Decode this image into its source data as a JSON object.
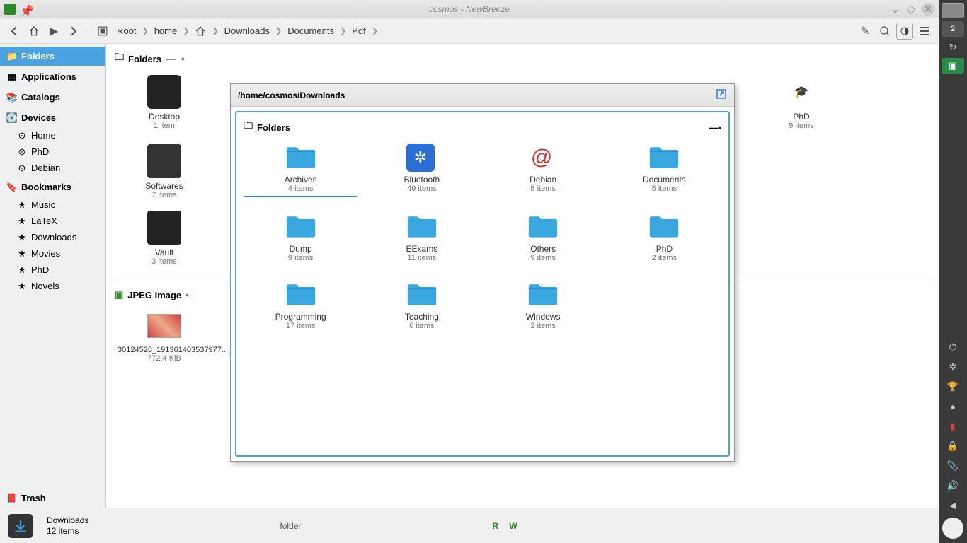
{
  "window": {
    "title": "cosmos - NewBreeze"
  },
  "breadcrumb": {
    "root": "Root",
    "home": "home",
    "downloads": "Downloads",
    "documents": "Documents",
    "pdf": "Pdf"
  },
  "sidebar": {
    "folders": "Folders",
    "applications": "Applications",
    "catalogs": "Catalogs",
    "devices": "Devices",
    "dev": {
      "home": "Home",
      "phd": "PhD",
      "debian": "Debian"
    },
    "bookmarks": "Bookmarks",
    "bm": {
      "music": "Music",
      "latex": "LaTeX",
      "downloads": "Downloads",
      "movies": "Movies",
      "phd": "PhD",
      "novels": "Novels"
    },
    "trash": "Trash"
  },
  "content": {
    "folders_header": "Folders",
    "jpeg_header": "JPEG Image",
    "items": {
      "desktop": {
        "name": "Desktop",
        "sub": "1 item"
      },
      "vault": {
        "name": "Vault",
        "sub": "3 items"
      },
      "phd": {
        "name": "PhD",
        "sub": "9 items"
      },
      "softwares": {
        "name": "Softwares",
        "sub": "7 items"
      }
    },
    "jpeg": {
      "name": "30124528_191361403537977...",
      "size": "772.4 KiB"
    }
  },
  "popup": {
    "path": "/home/cosmos/Downloads",
    "folders_header": "Folders",
    "items": [
      {
        "name": "Archives",
        "sub": "4 items",
        "type": "folder",
        "selected": true
      },
      {
        "name": "Bluetooth",
        "sub": "49 items",
        "type": "bluetooth"
      },
      {
        "name": "Debian",
        "sub": "5 items",
        "type": "debian"
      },
      {
        "name": "Documents",
        "sub": "5 items",
        "type": "folder"
      },
      {
        "name": "Dump",
        "sub": "9 items",
        "type": "folder"
      },
      {
        "name": "EExams",
        "sub": "11 items",
        "type": "folder"
      },
      {
        "name": "Others",
        "sub": "9 items",
        "type": "folder"
      },
      {
        "name": "PhD",
        "sub": "2 items",
        "type": "folder"
      },
      {
        "name": "Programming",
        "sub": "17 items",
        "type": "folder"
      },
      {
        "name": "Teaching",
        "sub": "6 items",
        "type": "folder"
      },
      {
        "name": "Windows",
        "sub": "2 items",
        "type": "folder"
      }
    ]
  },
  "statusbar": {
    "dl_name": "Downloads",
    "dl_count": "12 items",
    "type": "folder",
    "rw": "R W"
  },
  "panel": {
    "badge": "2"
  }
}
